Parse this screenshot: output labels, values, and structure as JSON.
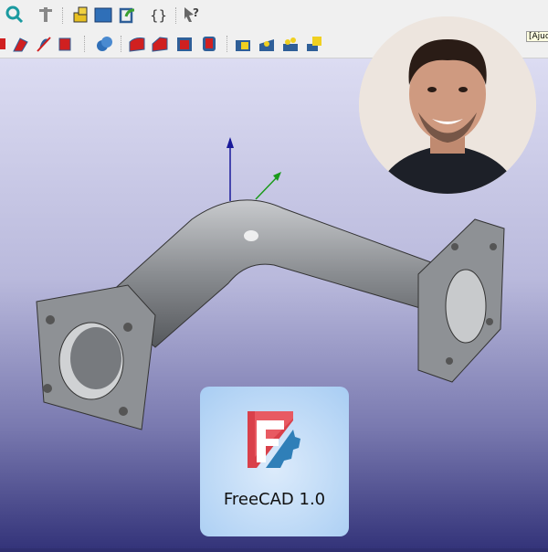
{
  "toolbar_top": {
    "icons": [
      "zoom-icon",
      "measure-icon",
      "part-icon",
      "folder-icon",
      "export-icon",
      "macro-icon",
      "whats-this-icon"
    ]
  },
  "toolbar_part": {
    "icons": [
      "extrude-icon",
      "revolve-icon",
      "mirror-icon",
      "box-icon",
      "boolean-icon",
      "fillet-icon",
      "chamfer-icon",
      "thickness-icon",
      "offset-icon",
      "primitives-icon",
      "compound-icon",
      "explode-icon",
      "attachment-icon"
    ]
  },
  "tooltip": "[Ajuda",
  "card": {
    "label": "FreeCAD 1.0"
  },
  "colors": {
    "toolbar": "#f0f0f0",
    "viewport_top": "#dcdcf2",
    "viewport_bottom": "#34347a",
    "axis_z": "#1a1a9a",
    "axis_y": "#1a9a1a",
    "logo_red": "#d9404a",
    "logo_blue": "#2f7fb8"
  }
}
